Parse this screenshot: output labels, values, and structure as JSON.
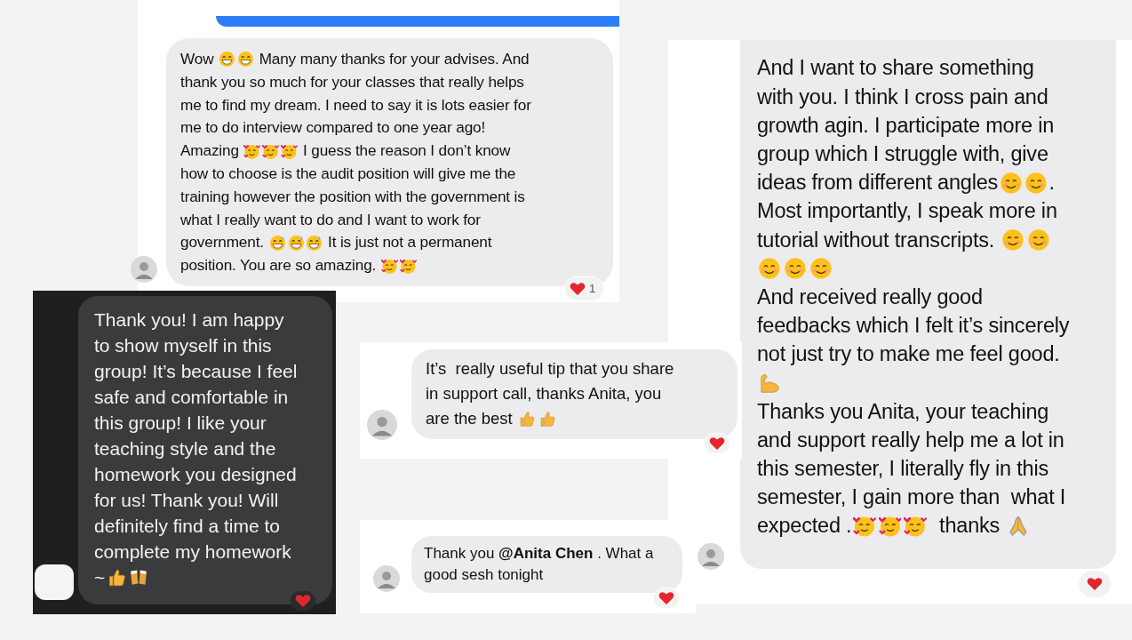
{
  "messages": [
    {
      "kind": "light",
      "reacted": true,
      "reaction_count": "1",
      "paragraphs": [
        [
          [
            {
              "kind": "text",
              "text": "Wow "
            },
            {
              "kind": "grin"
            },
            {
              "kind": "grin"
            },
            {
              "kind": "text",
              "text": " Many many thanks for your advises. And"
            }
          ],
          [
            {
              "kind": "text",
              "text": "thank you so much for your classes that really helps"
            }
          ],
          [
            {
              "kind": "text",
              "text": "me to find my dream. I need to say it is lots easier for"
            }
          ],
          [
            {
              "kind": "text",
              "text": "me to do interview compared to one year ago!"
            }
          ],
          [
            {
              "kind": "text",
              "text": "Amazing "
            },
            {
              "kind": "hearts"
            },
            {
              "kind": "hearts"
            },
            {
              "kind": "hearts"
            },
            {
              "kind": "text",
              "text": " I guess the reason I don’t know"
            }
          ],
          [
            {
              "kind": "text",
              "text": "how to choose is the audit position will give me the"
            }
          ],
          [
            {
              "kind": "text",
              "text": "training however the position with the government is"
            }
          ],
          [
            {
              "kind": "text",
              "text": "what I really want to do and I want to work for"
            }
          ],
          [
            {
              "kind": "text",
              "text": "government. "
            },
            {
              "kind": "sweat"
            },
            {
              "kind": "sweat"
            },
            {
              "kind": "sweat"
            },
            {
              "kind": "text",
              "text": " It is just not a permanent"
            }
          ],
          [
            {
              "kind": "text",
              "text": "position. You are so amazing. "
            },
            {
              "kind": "hearts"
            },
            {
              "kind": "hearts"
            }
          ]
        ]
      ]
    },
    {
      "kind": "dark",
      "reacted": true,
      "paragraphs": [
        [
          [
            {
              "kind": "text",
              "text": "Thank you! I am happy"
            }
          ],
          [
            {
              "kind": "text",
              "text": "to show myself in this"
            }
          ],
          [
            {
              "kind": "text",
              "text": "group! It’s because I feel"
            }
          ],
          [
            {
              "kind": "text",
              "text": "safe and comfortable in"
            }
          ],
          [
            {
              "kind": "text",
              "text": "this group! I like your"
            }
          ],
          [
            {
              "kind": "text",
              "text": "teaching style and the"
            }
          ],
          [
            {
              "kind": "text",
              "text": "homework you designed"
            }
          ],
          [
            {
              "kind": "text",
              "text": "for us! Thank you! Will"
            }
          ],
          [
            {
              "kind": "text",
              "text": "definitely find a time to"
            }
          ],
          [
            {
              "kind": "text",
              "text": "complete my homework"
            }
          ],
          [
            {
              "kind": "text",
              "text": "~"
            },
            {
              "kind": "thumbs"
            },
            {
              "kind": "beers"
            }
          ]
        ]
      ]
    },
    {
      "kind": "light",
      "reacted": true,
      "paragraphs": [
        [
          [
            {
              "kind": "text",
              "text": "It’s  really useful tip that you share"
            }
          ],
          [
            {
              "kind": "text",
              "text": "in support call, thanks Anita, you"
            }
          ],
          [
            {
              "kind": "text",
              "text": "are the best "
            },
            {
              "kind": "thumbs"
            },
            {
              "kind": "thumbs"
            }
          ]
        ]
      ]
    },
    {
      "kind": "light",
      "reacted": true,
      "paragraphs": [
        [
          [
            {
              "kind": "text",
              "text": "Thank you **@Anita Chen** . What a"
            }
          ],
          [
            {
              "kind": "text",
              "text": "good sesh tonight"
            }
          ]
        ]
      ]
    },
    {
      "kind": "light",
      "reacted": true,
      "paragraphs": [
        [
          [
            {
              "kind": "text",
              "text": "And I want to share something"
            }
          ],
          [
            {
              "kind": "text",
              "text": "with you. I think I cross pain and"
            }
          ],
          [
            {
              "kind": "text",
              "text": "growth agin. I participate more in"
            }
          ],
          [
            {
              "kind": "text",
              "text": "group which I struggle with, give"
            }
          ],
          [
            {
              "kind": "text",
              "text": "ideas from different angles"
            },
            {
              "kind": "smile"
            },
            {
              "kind": "smile"
            },
            {
              "kind": "text",
              "text": "."
            }
          ],
          [
            {
              "kind": "text",
              "text": "Most importantly, I speak more in"
            }
          ],
          [
            {
              "kind": "text",
              "text": "tutorial without transcripts. "
            },
            {
              "kind": "smile"
            },
            {
              "kind": "smile"
            }
          ],
          [
            {
              "kind": "smile"
            },
            {
              "kind": "smile"
            },
            {
              "kind": "smile"
            }
          ],
          [
            {
              "kind": "text",
              "text": "And received really good"
            }
          ],
          [
            {
              "kind": "text",
              "text": "feedbacks which I felt it’s sincerely"
            }
          ],
          [
            {
              "kind": "text",
              "text": "not just try to make me feel good."
            }
          ],
          [
            {
              "kind": "muscle"
            }
          ]
        ],
        [
          [
            {
              "kind": "text",
              "text": "Thanks you Anita, your teaching"
            }
          ],
          [
            {
              "kind": "text",
              "text": "and support really help me a lot in"
            }
          ],
          [
            {
              "kind": "text",
              "text": "this semester, I literally fly in this"
            }
          ],
          [
            {
              "kind": "text",
              "text": "semester, I gain more than  what I"
            }
          ],
          [
            {
              "kind": "text",
              "text": "expected ."
            },
            {
              "kind": "hearts"
            },
            {
              "kind": "hearts"
            },
            {
              "kind": "hearts"
            },
            {
              "kind": "text",
              "text": "  thanks "
            },
            {
              "kind": "pray"
            }
          ]
        ]
      ]
    }
  ]
}
